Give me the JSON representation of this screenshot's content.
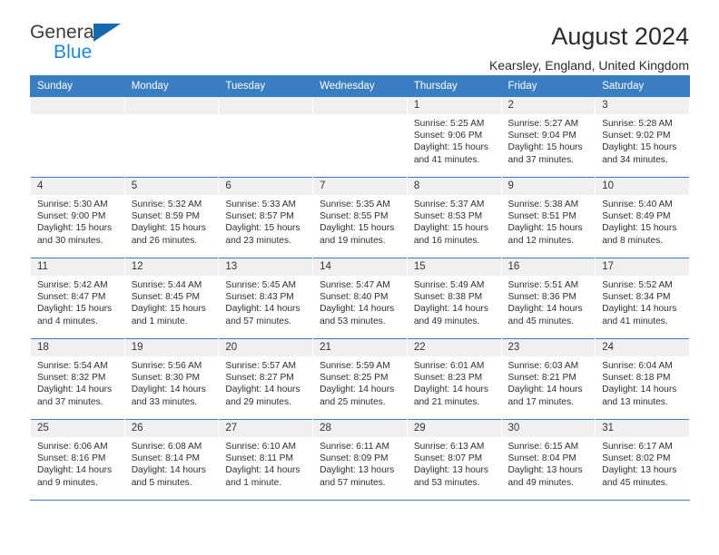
{
  "branding": {
    "logo_primary": "General",
    "logo_secondary": "Blue",
    "logo_triangle_color": "#1769b0",
    "logo_secondary_color": "#1f86d8"
  },
  "header": {
    "title": "August 2024",
    "subtitle": "Kearsley, England, United Kingdom"
  },
  "theme": {
    "header_bg": "#3a7dc0",
    "daynum_bg": "#f0f0f0",
    "grid_line": "#3a7dc0",
    "text": "#2f2f2f"
  },
  "calendar": {
    "weekday_headers": [
      "Sunday",
      "Monday",
      "Tuesday",
      "Wednesday",
      "Thursday",
      "Friday",
      "Saturday"
    ],
    "weeks": [
      [
        {
          "day": "",
          "empty": true
        },
        {
          "day": "",
          "empty": true
        },
        {
          "day": "",
          "empty": true
        },
        {
          "day": "",
          "empty": true
        },
        {
          "day": "1",
          "sunrise": "Sunrise: 5:25 AM",
          "sunset": "Sunset: 9:06 PM",
          "daylight": "Daylight: 15 hours and 41 minutes."
        },
        {
          "day": "2",
          "sunrise": "Sunrise: 5:27 AM",
          "sunset": "Sunset: 9:04 PM",
          "daylight": "Daylight: 15 hours and 37 minutes."
        },
        {
          "day": "3",
          "sunrise": "Sunrise: 5:28 AM",
          "sunset": "Sunset: 9:02 PM",
          "daylight": "Daylight: 15 hours and 34 minutes."
        }
      ],
      [
        {
          "day": "4",
          "sunrise": "Sunrise: 5:30 AM",
          "sunset": "Sunset: 9:00 PM",
          "daylight": "Daylight: 15 hours and 30 minutes."
        },
        {
          "day": "5",
          "sunrise": "Sunrise: 5:32 AM",
          "sunset": "Sunset: 8:59 PM",
          "daylight": "Daylight: 15 hours and 26 minutes."
        },
        {
          "day": "6",
          "sunrise": "Sunrise: 5:33 AM",
          "sunset": "Sunset: 8:57 PM",
          "daylight": "Daylight: 15 hours and 23 minutes."
        },
        {
          "day": "7",
          "sunrise": "Sunrise: 5:35 AM",
          "sunset": "Sunset: 8:55 PM",
          "daylight": "Daylight: 15 hours and 19 minutes."
        },
        {
          "day": "8",
          "sunrise": "Sunrise: 5:37 AM",
          "sunset": "Sunset: 8:53 PM",
          "daylight": "Daylight: 15 hours and 16 minutes."
        },
        {
          "day": "9",
          "sunrise": "Sunrise: 5:38 AM",
          "sunset": "Sunset: 8:51 PM",
          "daylight": "Daylight: 15 hours and 12 minutes."
        },
        {
          "day": "10",
          "sunrise": "Sunrise: 5:40 AM",
          "sunset": "Sunset: 8:49 PM",
          "daylight": "Daylight: 15 hours and 8 minutes."
        }
      ],
      [
        {
          "day": "11",
          "sunrise": "Sunrise: 5:42 AM",
          "sunset": "Sunset: 8:47 PM",
          "daylight": "Daylight: 15 hours and 4 minutes."
        },
        {
          "day": "12",
          "sunrise": "Sunrise: 5:44 AM",
          "sunset": "Sunset: 8:45 PM",
          "daylight": "Daylight: 15 hours and 1 minute."
        },
        {
          "day": "13",
          "sunrise": "Sunrise: 5:45 AM",
          "sunset": "Sunset: 8:43 PM",
          "daylight": "Daylight: 14 hours and 57 minutes."
        },
        {
          "day": "14",
          "sunrise": "Sunrise: 5:47 AM",
          "sunset": "Sunset: 8:40 PM",
          "daylight": "Daylight: 14 hours and 53 minutes."
        },
        {
          "day": "15",
          "sunrise": "Sunrise: 5:49 AM",
          "sunset": "Sunset: 8:38 PM",
          "daylight": "Daylight: 14 hours and 49 minutes."
        },
        {
          "day": "16",
          "sunrise": "Sunrise: 5:51 AM",
          "sunset": "Sunset: 8:36 PM",
          "daylight": "Daylight: 14 hours and 45 minutes."
        },
        {
          "day": "17",
          "sunrise": "Sunrise: 5:52 AM",
          "sunset": "Sunset: 8:34 PM",
          "daylight": "Daylight: 14 hours and 41 minutes."
        }
      ],
      [
        {
          "day": "18",
          "sunrise": "Sunrise: 5:54 AM",
          "sunset": "Sunset: 8:32 PM",
          "daylight": "Daylight: 14 hours and 37 minutes."
        },
        {
          "day": "19",
          "sunrise": "Sunrise: 5:56 AM",
          "sunset": "Sunset: 8:30 PM",
          "daylight": "Daylight: 14 hours and 33 minutes."
        },
        {
          "day": "20",
          "sunrise": "Sunrise: 5:57 AM",
          "sunset": "Sunset: 8:27 PM",
          "daylight": "Daylight: 14 hours and 29 minutes."
        },
        {
          "day": "21",
          "sunrise": "Sunrise: 5:59 AM",
          "sunset": "Sunset: 8:25 PM",
          "daylight": "Daylight: 14 hours and 25 minutes."
        },
        {
          "day": "22",
          "sunrise": "Sunrise: 6:01 AM",
          "sunset": "Sunset: 8:23 PM",
          "daylight": "Daylight: 14 hours and 21 minutes."
        },
        {
          "day": "23",
          "sunrise": "Sunrise: 6:03 AM",
          "sunset": "Sunset: 8:21 PM",
          "daylight": "Daylight: 14 hours and 17 minutes."
        },
        {
          "day": "24",
          "sunrise": "Sunrise: 6:04 AM",
          "sunset": "Sunset: 8:18 PM",
          "daylight": "Daylight: 14 hours and 13 minutes."
        }
      ],
      [
        {
          "day": "25",
          "sunrise": "Sunrise: 6:06 AM",
          "sunset": "Sunset: 8:16 PM",
          "daylight": "Daylight: 14 hours and 9 minutes."
        },
        {
          "day": "26",
          "sunrise": "Sunrise: 6:08 AM",
          "sunset": "Sunset: 8:14 PM",
          "daylight": "Daylight: 14 hours and 5 minutes."
        },
        {
          "day": "27",
          "sunrise": "Sunrise: 6:10 AM",
          "sunset": "Sunset: 8:11 PM",
          "daylight": "Daylight: 14 hours and 1 minute."
        },
        {
          "day": "28",
          "sunrise": "Sunrise: 6:11 AM",
          "sunset": "Sunset: 8:09 PM",
          "daylight": "Daylight: 13 hours and 57 minutes."
        },
        {
          "day": "29",
          "sunrise": "Sunrise: 6:13 AM",
          "sunset": "Sunset: 8:07 PM",
          "daylight": "Daylight: 13 hours and 53 minutes."
        },
        {
          "day": "30",
          "sunrise": "Sunrise: 6:15 AM",
          "sunset": "Sunset: 8:04 PM",
          "daylight": "Daylight: 13 hours and 49 minutes."
        },
        {
          "day": "31",
          "sunrise": "Sunrise: 6:17 AM",
          "sunset": "Sunset: 8:02 PM",
          "daylight": "Daylight: 13 hours and 45 minutes."
        }
      ]
    ]
  }
}
